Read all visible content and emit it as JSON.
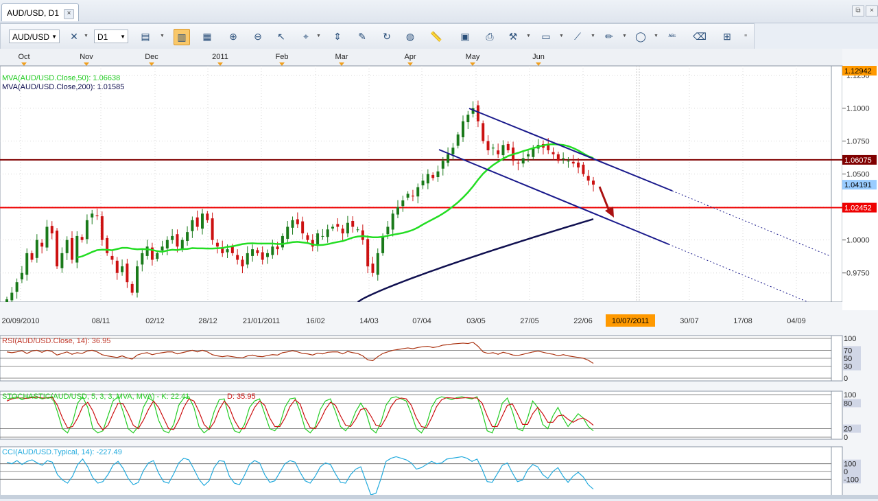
{
  "window": {
    "tab_title": "AUD/USD, D1",
    "tab_close": "×",
    "restore": "⧉",
    "close": "×"
  },
  "toolbar": {
    "symbol": "AUD/USD",
    "period": "D1"
  },
  "chart_data": [
    {
      "type": "candlestick",
      "top_axis_months": [
        "Oct",
        "Nov",
        "Dec",
        "2011",
        "Feb",
        "Mar",
        "Apr",
        "May",
        "Jun"
      ],
      "x_tick_labels": [
        "20/09/2010",
        "08/11",
        "02/12",
        "28/12",
        "21/01/2011",
        "16/02",
        "14/03",
        "07/04",
        "03/05",
        "27/05",
        "22/06",
        "30/07",
        "17/08",
        "04/09"
      ],
      "cursor_date": "10/07/2011",
      "y_ticks": [
        0.975,
        1.0,
        1.025,
        1.05,
        1.075,
        1.1,
        1.125
      ],
      "y_tick_labels": [
        "0.9750",
        "1.0000",
        "1.0250",
        "1.0500",
        "1.0750",
        "1.1000",
        "1.1250"
      ],
      "ylim": [
        0.953,
        1.132
      ],
      "indicators": [
        {
          "label": "MVA(AUD/USD.Close,50): 1.06638",
          "color": "#22cc22"
        },
        {
          "label": "MVA(AUD/USD.Close,200): 1.01585",
          "color": "#101050"
        }
      ],
      "price_labels": [
        {
          "text": "1.12942",
          "value": 1.12942,
          "bg": "#ff9900",
          "fg": "#000000"
        },
        {
          "text": "1.06075",
          "value": 1.06075,
          "bg": "#800000",
          "fg": "#ffffff"
        },
        {
          "text": "1.04191",
          "value": 1.04191,
          "bg": "#99ccff",
          "fg": "#000000"
        },
        {
          "text": "1.02452",
          "value": 1.02452,
          "bg": "#ee0000",
          "fg": "#ffffff"
        }
      ],
      "horizontal_levels": [
        {
          "value": 1.06075,
          "color": "#800000"
        },
        {
          "value": 1.02452,
          "color": "#ee0000"
        }
      ],
      "close": [
        0.955,
        0.96,
        0.968,
        0.975,
        0.99,
        0.985,
        1.0,
        0.995,
        1.01,
        1.005,
        0.98,
        0.99,
        1.0,
        0.985,
        1.003,
        1.0,
        1.015,
        1.02,
        1.018,
        1.0,
        0.99,
        0.985,
        0.975,
        0.98,
        0.968,
        0.96,
        0.98,
        0.99,
        0.995,
        0.985,
        0.99,
        0.995,
        1.0,
        1.003,
        0.995,
        1.0,
        1.006,
        1.015,
        1.01,
        1.02,
        1.015,
        1.0,
        0.995,
        0.99,
        0.993,
        0.99,
        0.985,
        0.98,
        0.99,
        0.993,
        0.99,
        0.985,
        0.99,
        0.995,
        0.993,
        1.003,
        1.01,
        1.015,
        1.012,
        1.005,
        1.0,
        0.995,
        1.005,
        1.003,
        1.008,
        1.01,
        1.01,
        1.005,
        1.013,
        1.01,
        1.008,
        1.0,
        0.98,
        0.975,
        0.99,
        1.003,
        1.01,
        1.02,
        1.025,
        1.03,
        1.035,
        1.033,
        1.04,
        1.045,
        1.05,
        1.047,
        1.052,
        1.06,
        1.065,
        1.07,
        1.08,
        1.09,
        1.095,
        1.1,
        1.09,
        1.075,
        1.068,
        1.07,
        1.065,
        1.072,
        1.068,
        1.06,
        1.058,
        1.062,
        1.065,
        1.07,
        1.072,
        1.07,
        1.068,
        1.065,
        1.06,
        1.062,
        1.06,
        1.058,
        1.055,
        1.05,
        1.045,
        1.042
      ]
    },
    {
      "type": "line",
      "title": "RSI(AUD/USD.Close, 14): 36.95",
      "ylim": [
        0,
        100
      ],
      "levels": [
        100,
        70,
        50,
        30,
        0
      ],
      "level_labels": [
        "100",
        "70",
        "50",
        "30",
        "0"
      ],
      "series": [
        {
          "values": [
            66,
            64,
            66,
            69,
            62,
            68,
            70,
            65,
            70,
            67,
            58,
            62,
            66,
            60,
            64,
            62,
            68,
            70,
            66,
            59,
            56,
            54,
            52,
            56,
            51,
            48,
            58,
            62,
            64,
            59,
            62,
            64,
            66,
            66,
            61,
            64,
            67,
            70,
            66,
            70,
            66,
            59,
            56,
            54,
            56,
            54,
            52,
            51,
            56,
            58,
            55,
            54,
            57,
            59,
            58,
            64,
            66,
            69,
            66,
            62,
            61,
            58,
            63,
            61,
            65,
            66,
            66,
            61,
            67,
            64,
            62,
            56,
            46,
            44,
            54,
            62,
            66,
            70,
            72,
            74,
            76,
            74,
            77,
            79,
            80,
            77,
            79,
            83,
            84,
            86,
            87,
            88,
            87,
            90,
            80,
            66,
            62,
            64,
            60,
            65,
            62,
            58,
            57,
            60,
            63,
            66,
            68,
            65,
            62,
            60,
            56,
            59,
            56,
            54,
            52,
            50,
            45,
            37
          ],
          "color": "#aa3311"
        }
      ]
    },
    {
      "type": "line",
      "title_stoch": "STOCHASTIC(AUD/USD, 5, 3, 3, MVA, MVA) -  K: 22.41",
      "title_d": "D: 35.95",
      "ylim": [
        0,
        100
      ],
      "levels": [
        100,
        80,
        20,
        0
      ],
      "level_labels": [
        "100",
        "80",
        "20",
        "0"
      ],
      "series": [
        {
          "name": "K",
          "color": "#22cc22",
          "values": [
            90,
            92,
            95,
            88,
            93,
            95,
            94,
            90,
            93,
            95,
            60,
            20,
            10,
            35,
            80,
            95,
            70,
            20,
            10,
            15,
            50,
            85,
            95,
            60,
            20,
            10,
            25,
            70,
            92,
            85,
            40,
            15,
            10,
            30,
            75,
            92,
            95,
            70,
            25,
            10,
            20,
            60,
            88,
            90,
            45,
            15,
            10,
            30,
            70,
            85,
            90,
            55,
            20,
            15,
            30,
            70,
            90,
            92,
            60,
            20,
            10,
            25,
            65,
            85,
            90,
            60,
            25,
            15,
            30,
            60,
            80,
            60,
            20,
            10,
            35,
            75,
            92,
            95,
            90,
            85,
            55,
            20,
            10,
            30,
            70,
            90,
            95,
            92,
            88,
            93,
            95,
            92,
            90,
            95,
            60,
            15,
            10,
            40,
            80,
            92,
            60,
            20,
            15,
            45,
            85,
            70,
            30,
            20,
            50,
            70,
            45,
            25,
            40,
            55,
            45,
            25,
            15
          ]
        },
        {
          "name": "D",
          "color": "#cc1111",
          "values": [
            85,
            90,
            92,
            92,
            91,
            93,
            94,
            92,
            92,
            93,
            75,
            45,
            22,
            25,
            45,
            72,
            82,
            62,
            33,
            17,
            28,
            55,
            80,
            78,
            55,
            28,
            20,
            40,
            65,
            85,
            70,
            45,
            20,
            18,
            40,
            70,
            90,
            85,
            60,
            30,
            18,
            35,
            65,
            85,
            70,
            40,
            20,
            20,
            45,
            70,
            85,
            75,
            45,
            25,
            25,
            45,
            72,
            88,
            78,
            45,
            22,
            20,
            40,
            65,
            82,
            75,
            50,
            28,
            25,
            42,
            65,
            68,
            50,
            28,
            25,
            45,
            72,
            88,
            92,
            90,
            75,
            45,
            25,
            22,
            45,
            72,
            88,
            93,
            92,
            91,
            92,
            93,
            92,
            92,
            80,
            50,
            25,
            25,
            50,
            75,
            78,
            55,
            30,
            30,
            55,
            70,
            55,
            35,
            35,
            50,
            52,
            42,
            35,
            42,
            45,
            38,
            28
          ]
        }
      ]
    },
    {
      "type": "line",
      "title": "CCI(AUD/USD.Typical, 14): -227.49",
      "ylim": [
        -300,
        300
      ],
      "levels": [
        100,
        0,
        -100
      ],
      "level_labels": [
        "100",
        "0",
        "-100"
      ],
      "series": [
        {
          "color": "#22aadd",
          "values": [
            120,
            100,
            140,
            90,
            130,
            150,
            110,
            80,
            140,
            120,
            -40,
            -110,
            -150,
            -60,
            90,
            160,
            60,
            -80,
            -150,
            -130,
            -40,
            80,
            130,
            40,
            -90,
            -170,
            -140,
            10,
            110,
            140,
            -20,
            -130,
            -150,
            -30,
            110,
            170,
            150,
            30,
            -100,
            -180,
            -120,
            50,
            140,
            130,
            -60,
            -150,
            -170,
            -50,
            90,
            140,
            110,
            -40,
            -140,
            -120,
            -10,
            100,
            140,
            120,
            -10,
            -120,
            -150,
            -60,
            60,
            110,
            90,
            -30,
            -140,
            -150,
            -40,
            30,
            60,
            -120,
            -300,
            -280,
            -90,
            130,
            170,
            190,
            170,
            150,
            110,
            30,
            50,
            90,
            130,
            100,
            110,
            160,
            170,
            180,
            190,
            170,
            130,
            160,
            30,
            -130,
            -140,
            -30,
            80,
            110,
            -20,
            -130,
            -110,
            20,
            90,
            60,
            -40,
            -90,
            0,
            50,
            -60,
            -140,
            -60,
            -10,
            -70,
            -170,
            -227
          ]
        }
      ]
    }
  ]
}
